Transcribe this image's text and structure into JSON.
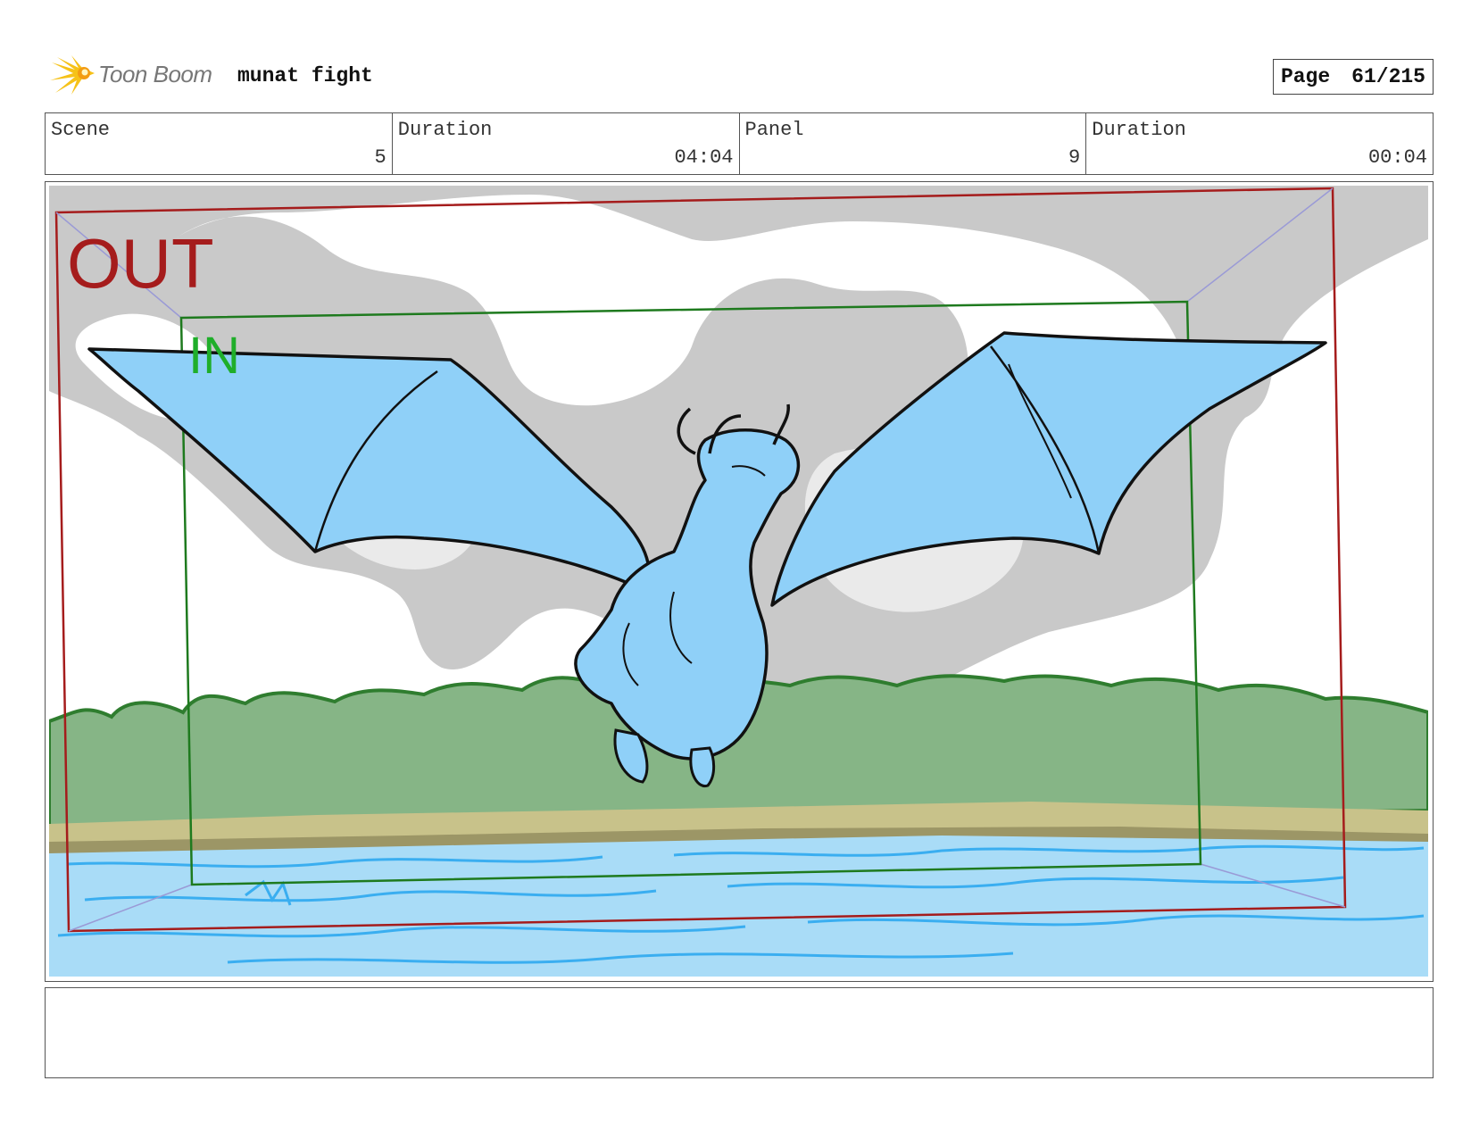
{
  "header": {
    "brand": "Toon Boom",
    "project_title": "munat fight",
    "page_label": "Page",
    "page_number": "61/215"
  },
  "info": {
    "scene_label": "Scene",
    "scene_value": "5",
    "scene_duration_label": "Duration",
    "scene_duration_value": "04:04",
    "panel_label": "Panel",
    "panel_value": "9",
    "panel_duration_label": "Duration",
    "panel_duration_value": "00:04"
  },
  "panel": {
    "out_label": "OUT",
    "in_label": "IN",
    "colors": {
      "out_frame": "#a51c1c",
      "in_frame": "#1e7a1e",
      "in_text": "#1fae2a",
      "sky_cloud": "#c9c9c9",
      "trees": "#86b586",
      "tree_outline": "#2f7d2f",
      "sand": "#c8c28a",
      "water": "#a9dcf7",
      "water_lines": "#3aaef0",
      "dragon": "#8fd0f8"
    }
  },
  "notes": {
    "text": ""
  }
}
